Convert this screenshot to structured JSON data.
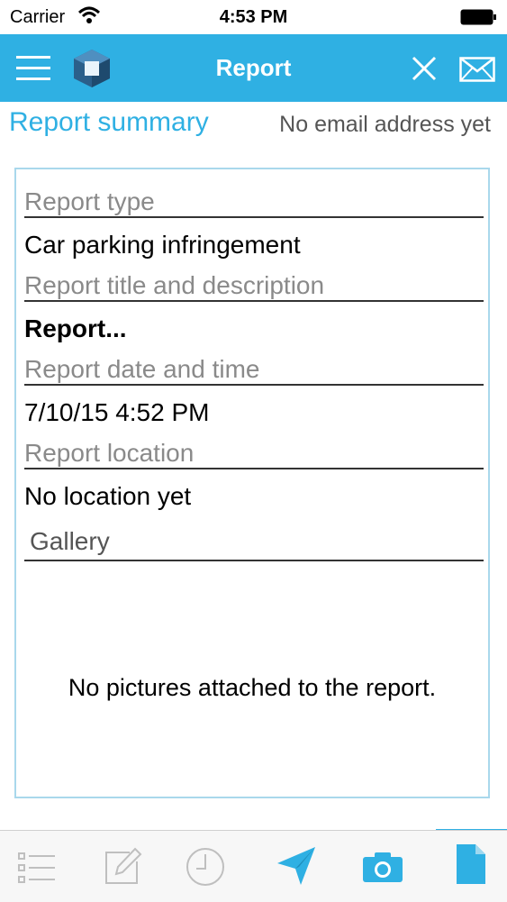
{
  "status": {
    "carrier": "Carrier",
    "time": "4:53 PM"
  },
  "nav": {
    "title": "Report",
    "icons": [
      "menu-icon",
      "cube-logo-icon",
      "close-icon",
      "mail-icon"
    ]
  },
  "summary": {
    "title": "Report summary",
    "email": "No email address yet"
  },
  "report": {
    "type_label": "Report type",
    "type_value": "Car parking infringement",
    "title_label": "Report title and description",
    "title_value": "Report...",
    "date_label": "Report date and time",
    "date_value": "7/10/15 4:52 PM",
    "location_label": "Report location",
    "location_value": "No location yet",
    "gallery_label": "Gallery",
    "gallery_empty": "No pictures attached to the report."
  },
  "tabs": {
    "items": [
      "list-icon",
      "edit-icon",
      "clock-icon",
      "send-icon",
      "camera-icon",
      "document-icon"
    ],
    "active_index": 5
  },
  "colors": {
    "accent": "#2fb0e3",
    "inactive_icon": "#bfbfbf"
  }
}
